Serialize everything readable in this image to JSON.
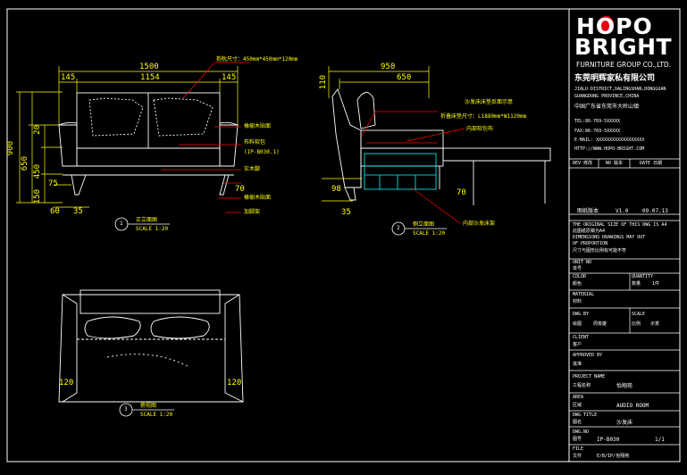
{
  "brand": {
    "logo_line1": "HOPO",
    "logo_line2": "BRIGHT",
    "group": "FURNITURE GROUP CO.,LTD.",
    "company_cn": "东莞明辉家私有限公司",
    "address_en1": "JIALU DISTRICT,DALINGSHAN,DONGGUAN",
    "address_en2": "GUANGDONG PROVINCE,CHINA",
    "address_cn": "中国广东省东莞市大岭山镇",
    "tel": "TEL:86-769-5XXXXX",
    "fax": "FAX:86-769-5XXXXX",
    "email": "E-MAIL: XXXXXXXXXXXXXXXXXX",
    "web": "HTTP://WWW.HOPO-BRIGHT.COM"
  },
  "title_block": {
    "rev_header": [
      "REV 修改",
      "NO 版本",
      "DATE 日期"
    ],
    "version_label": "图纸版本",
    "version": "V1.0",
    "version_date": "09.07.13",
    "notice_en": "THE ORIGINAL SIZE OF THIS DWG IS A4",
    "notice_cn": "此图纸原稿为A4",
    "dim_en1": "DIMENSIONS DRAWINGS MAY OUT",
    "dim_en2": "OF PROPORTION",
    "dim_cn": "尺寸与图形比例有可能不符",
    "unit_label": "UNIT NO",
    "unit_cn": "单号",
    "color_label": "COLOR",
    "color_cn": "颜色",
    "quantity_label": "QUANTITY",
    "quantity_cn": "数量",
    "quantity_value": "1件",
    "material_label": "MATERIAL",
    "material_cn": "材料",
    "dwg_by_label": "DWG BY",
    "dwg_by_cn": "绘图",
    "dwg_by_value": "周俊雄",
    "scale_label": "SCALE",
    "scale_cn": "比例",
    "scale_value": "示意",
    "client_label": "CLIENT",
    "client_cn": "客户",
    "approved_label": "APPROVED BY",
    "approved_cn": "批准",
    "project_label": "PROJECT NAME",
    "project_cn": "工程名称",
    "project_value": "怡翔苑",
    "area_label": "AREA",
    "area_cn": "区域",
    "area_value": "AUDIO ROOM",
    "dwg_title_label": "DWG TITLE",
    "dwg_title_cn": "图名",
    "dwg_title_value": "沙发床",
    "dwg_no_label": "DWG.NO",
    "dwg_no_cn": "图号",
    "dwg_no_value": "IP-B030",
    "sheet": "1/1",
    "file_label": "FILE",
    "file_cn": "文件",
    "file_value": "E/B/IP/怡翔苑"
  },
  "front_view": {
    "dim_overall": "1500",
    "dim_side_left": "145",
    "dim_middle": "1154",
    "dim_side_right": "145",
    "dim_height": "900",
    "dim_650": "650",
    "dim_20": "20",
    "dim_450": "450",
    "dim_150": "150",
    "dim_75": "75",
    "dim_60": "60",
    "dim_35": "35",
    "dim_70": "70",
    "callout_cushion": "抱枕尺寸：450mm*450mm*120mm",
    "callout_oak1": "橡樹木貼面",
    "callout_fabric1": "布料软包",
    "callout_fabric2": "(IP-B030.1)",
    "callout_wood": "实木腳",
    "callout_oak2": "橡樹木貼面",
    "callout_metal": "加脚架",
    "caption_num": "1",
    "caption_cn": "正立面图",
    "caption_scale": "SCALE 1:20"
  },
  "side_view": {
    "dim_950": "950",
    "dim_650": "650",
    "dim_110": "110",
    "dim_98": "98",
    "dim_35": "35",
    "dim_70": "70",
    "callout_bed1": "沙发床床垫反面示意",
    "callout_bed2": "折叠床垫尺寸：L1880mm*W1120mm",
    "callout_fabric": "内部软包布",
    "callout_inner": "内部沙发床架",
    "caption_num": "2",
    "caption_cn": "侧立面图",
    "caption_scale": "SCALE 1:20"
  },
  "plan_view": {
    "dim_120_left": "120",
    "dim_120_right": "120",
    "caption_num": "3",
    "caption_cn": "俯视图",
    "caption_scale": "SCALE 1:20"
  },
  "colors": {
    "line": "#ffffff",
    "dimension": "#ffff00",
    "leader": "#ff0000",
    "hidden": "#00ffff",
    "brand_red": "#e60012"
  }
}
